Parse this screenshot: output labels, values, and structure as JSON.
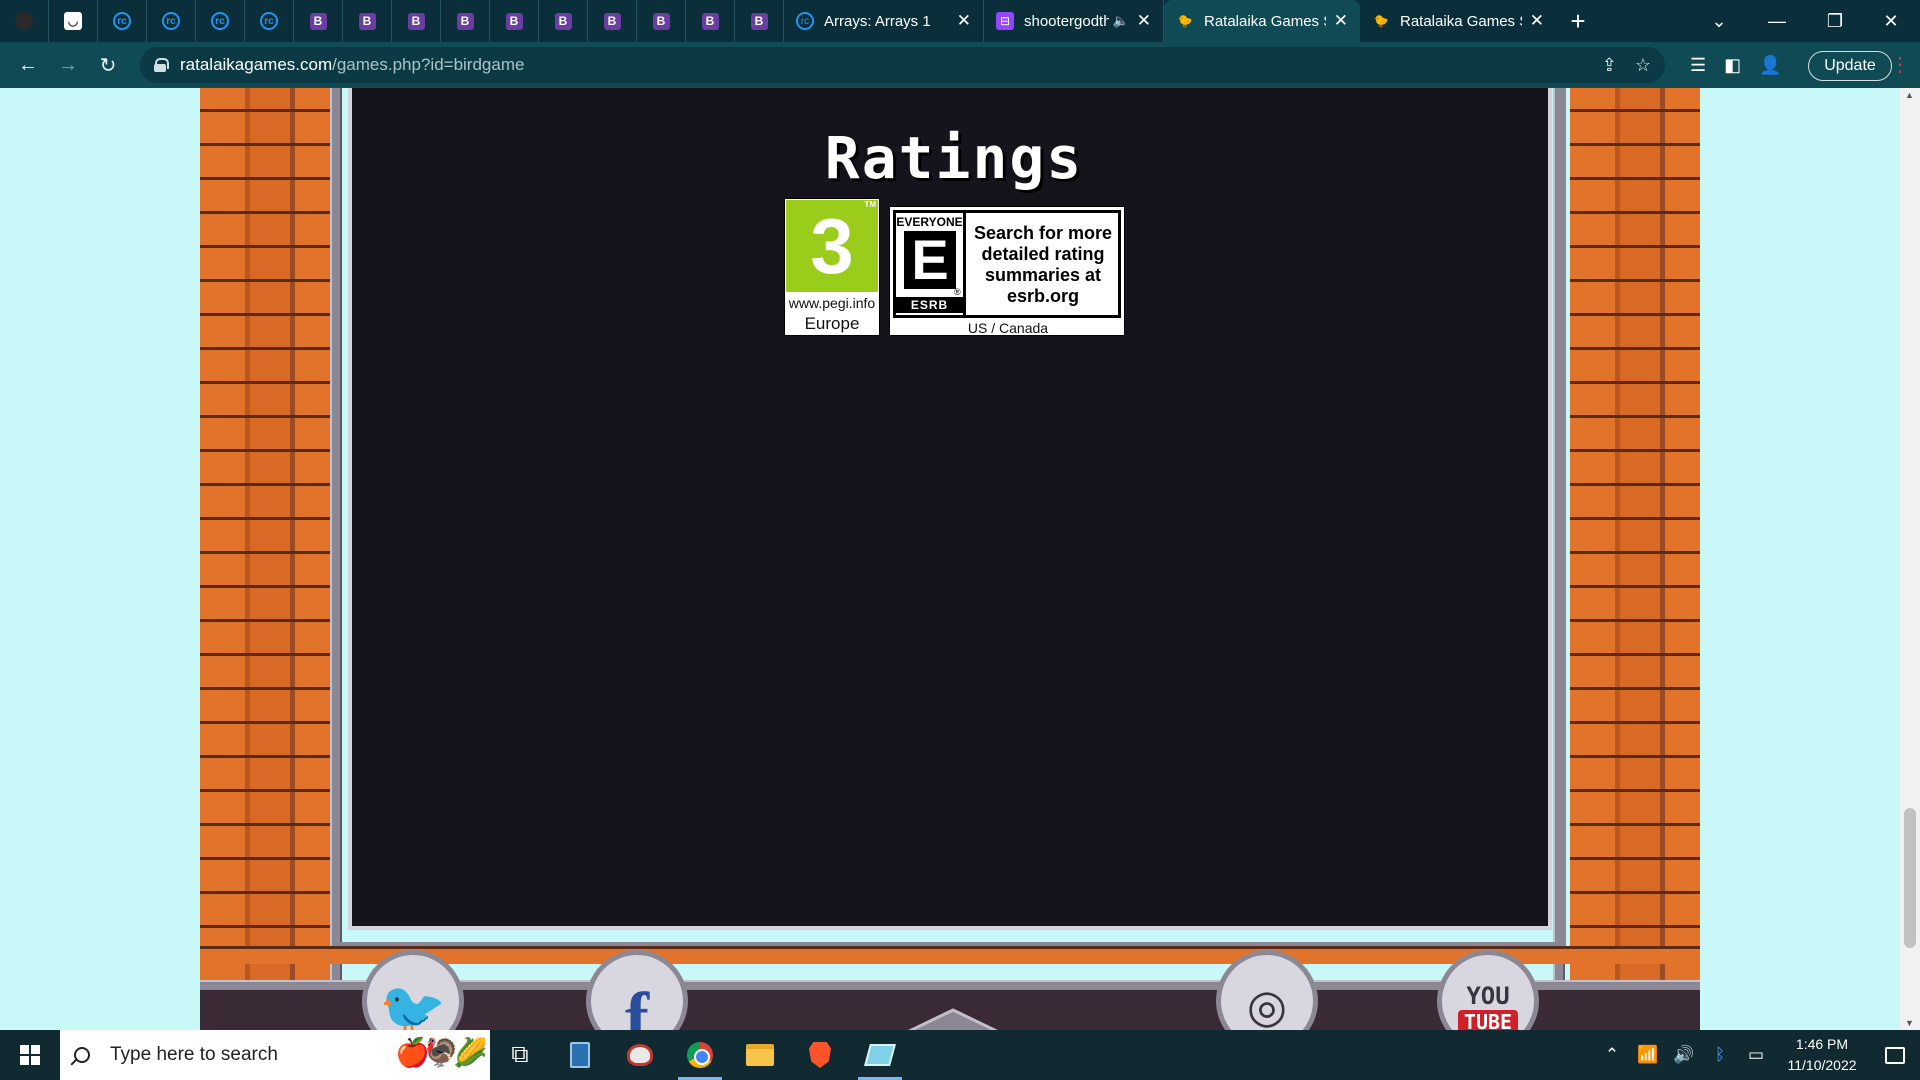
{
  "tabs": {
    "mini": [
      {
        "icon": "blank-tab-icon",
        "glyph": ""
      },
      {
        "icon": "white-doc-icon",
        "glyph": "◡"
      },
      {
        "icon": "replit-icon",
        "glyph": "rc"
      },
      {
        "icon": "replit-icon",
        "glyph": "rc"
      },
      {
        "icon": "replit-icon",
        "glyph": "rc"
      },
      {
        "icon": "replit-icon",
        "glyph": "rc"
      },
      {
        "icon": "b-icon",
        "glyph": "B"
      },
      {
        "icon": "b-icon",
        "glyph": "B"
      },
      {
        "icon": "b-icon",
        "glyph": "B"
      },
      {
        "icon": "b-icon",
        "glyph": "B"
      },
      {
        "icon": "b-icon",
        "glyph": "B"
      },
      {
        "icon": "b-icon",
        "glyph": "B"
      },
      {
        "icon": "b-icon",
        "glyph": "B"
      },
      {
        "icon": "b-icon",
        "glyph": "B"
      },
      {
        "icon": "b-icon",
        "glyph": "B"
      },
      {
        "icon": "b-icon",
        "glyph": "B"
      }
    ],
    "full": [
      {
        "label": "Arrays: Arrays 1",
        "icon": "replit-icon",
        "glyph": "rc",
        "close": "✕",
        "active": false
      },
      {
        "label": "shootergodth",
        "icon": "twitch-icon",
        "glyph": "⊟",
        "close": "✕",
        "muted": "🔈",
        "active": false
      },
      {
        "label": "Ratalaika Games S",
        "icon": "bird-icon",
        "glyph": "🐤",
        "close": "✕",
        "active": true
      },
      {
        "label": "Ratalaika Games S",
        "icon": "bird-icon",
        "glyph": "🐤",
        "close": "✕",
        "active": false
      }
    ],
    "new_tab": "+"
  },
  "window": {
    "tab_search": "⌄",
    "minimize": "—",
    "restore": "❐",
    "close": "✕"
  },
  "toolbar": {
    "back": "←",
    "forward": "→",
    "reload": "↻",
    "url_domain": "ratalaikagames.com",
    "url_path": "/games.php?id=birdgame",
    "share": "⇪",
    "bookmark": "☆",
    "reading_list": "☰",
    "side_panel": "◧",
    "profile": "👤",
    "update_label": "Update",
    "menu": "⋮"
  },
  "page": {
    "heading": "Ratings",
    "pegi": {
      "age": "3",
      "tm": "TM",
      "url": "www.pegi.info",
      "region": "Europe"
    },
    "esrb": {
      "everyone": "EVERYONE",
      "letter": "E",
      "reg": "®",
      "brand": "ESRB",
      "text": "Search for more detailed rating summaries at esrb.org",
      "region": "US / Canada"
    },
    "social": {
      "twitter_glyph": "🐦",
      "facebook_glyph": "f",
      "instagram_glyph": "◎",
      "youtube_you": "YOU",
      "youtube_tube": "TUBE"
    }
  },
  "scrollbar": {
    "up": "▲",
    "down": "▼"
  },
  "taskbar": {
    "search_placeholder": "Type here to search",
    "search_deco": "🍎🦃🌽",
    "task_view": "⧉",
    "clock_time": "1:46 PM",
    "clock_date": "11/10/2022",
    "tray": {
      "chevron": "⌃",
      "wifi": "📶",
      "volume": "🔊",
      "bluetooth": "ᛒ",
      "battery": "▭"
    }
  }
}
